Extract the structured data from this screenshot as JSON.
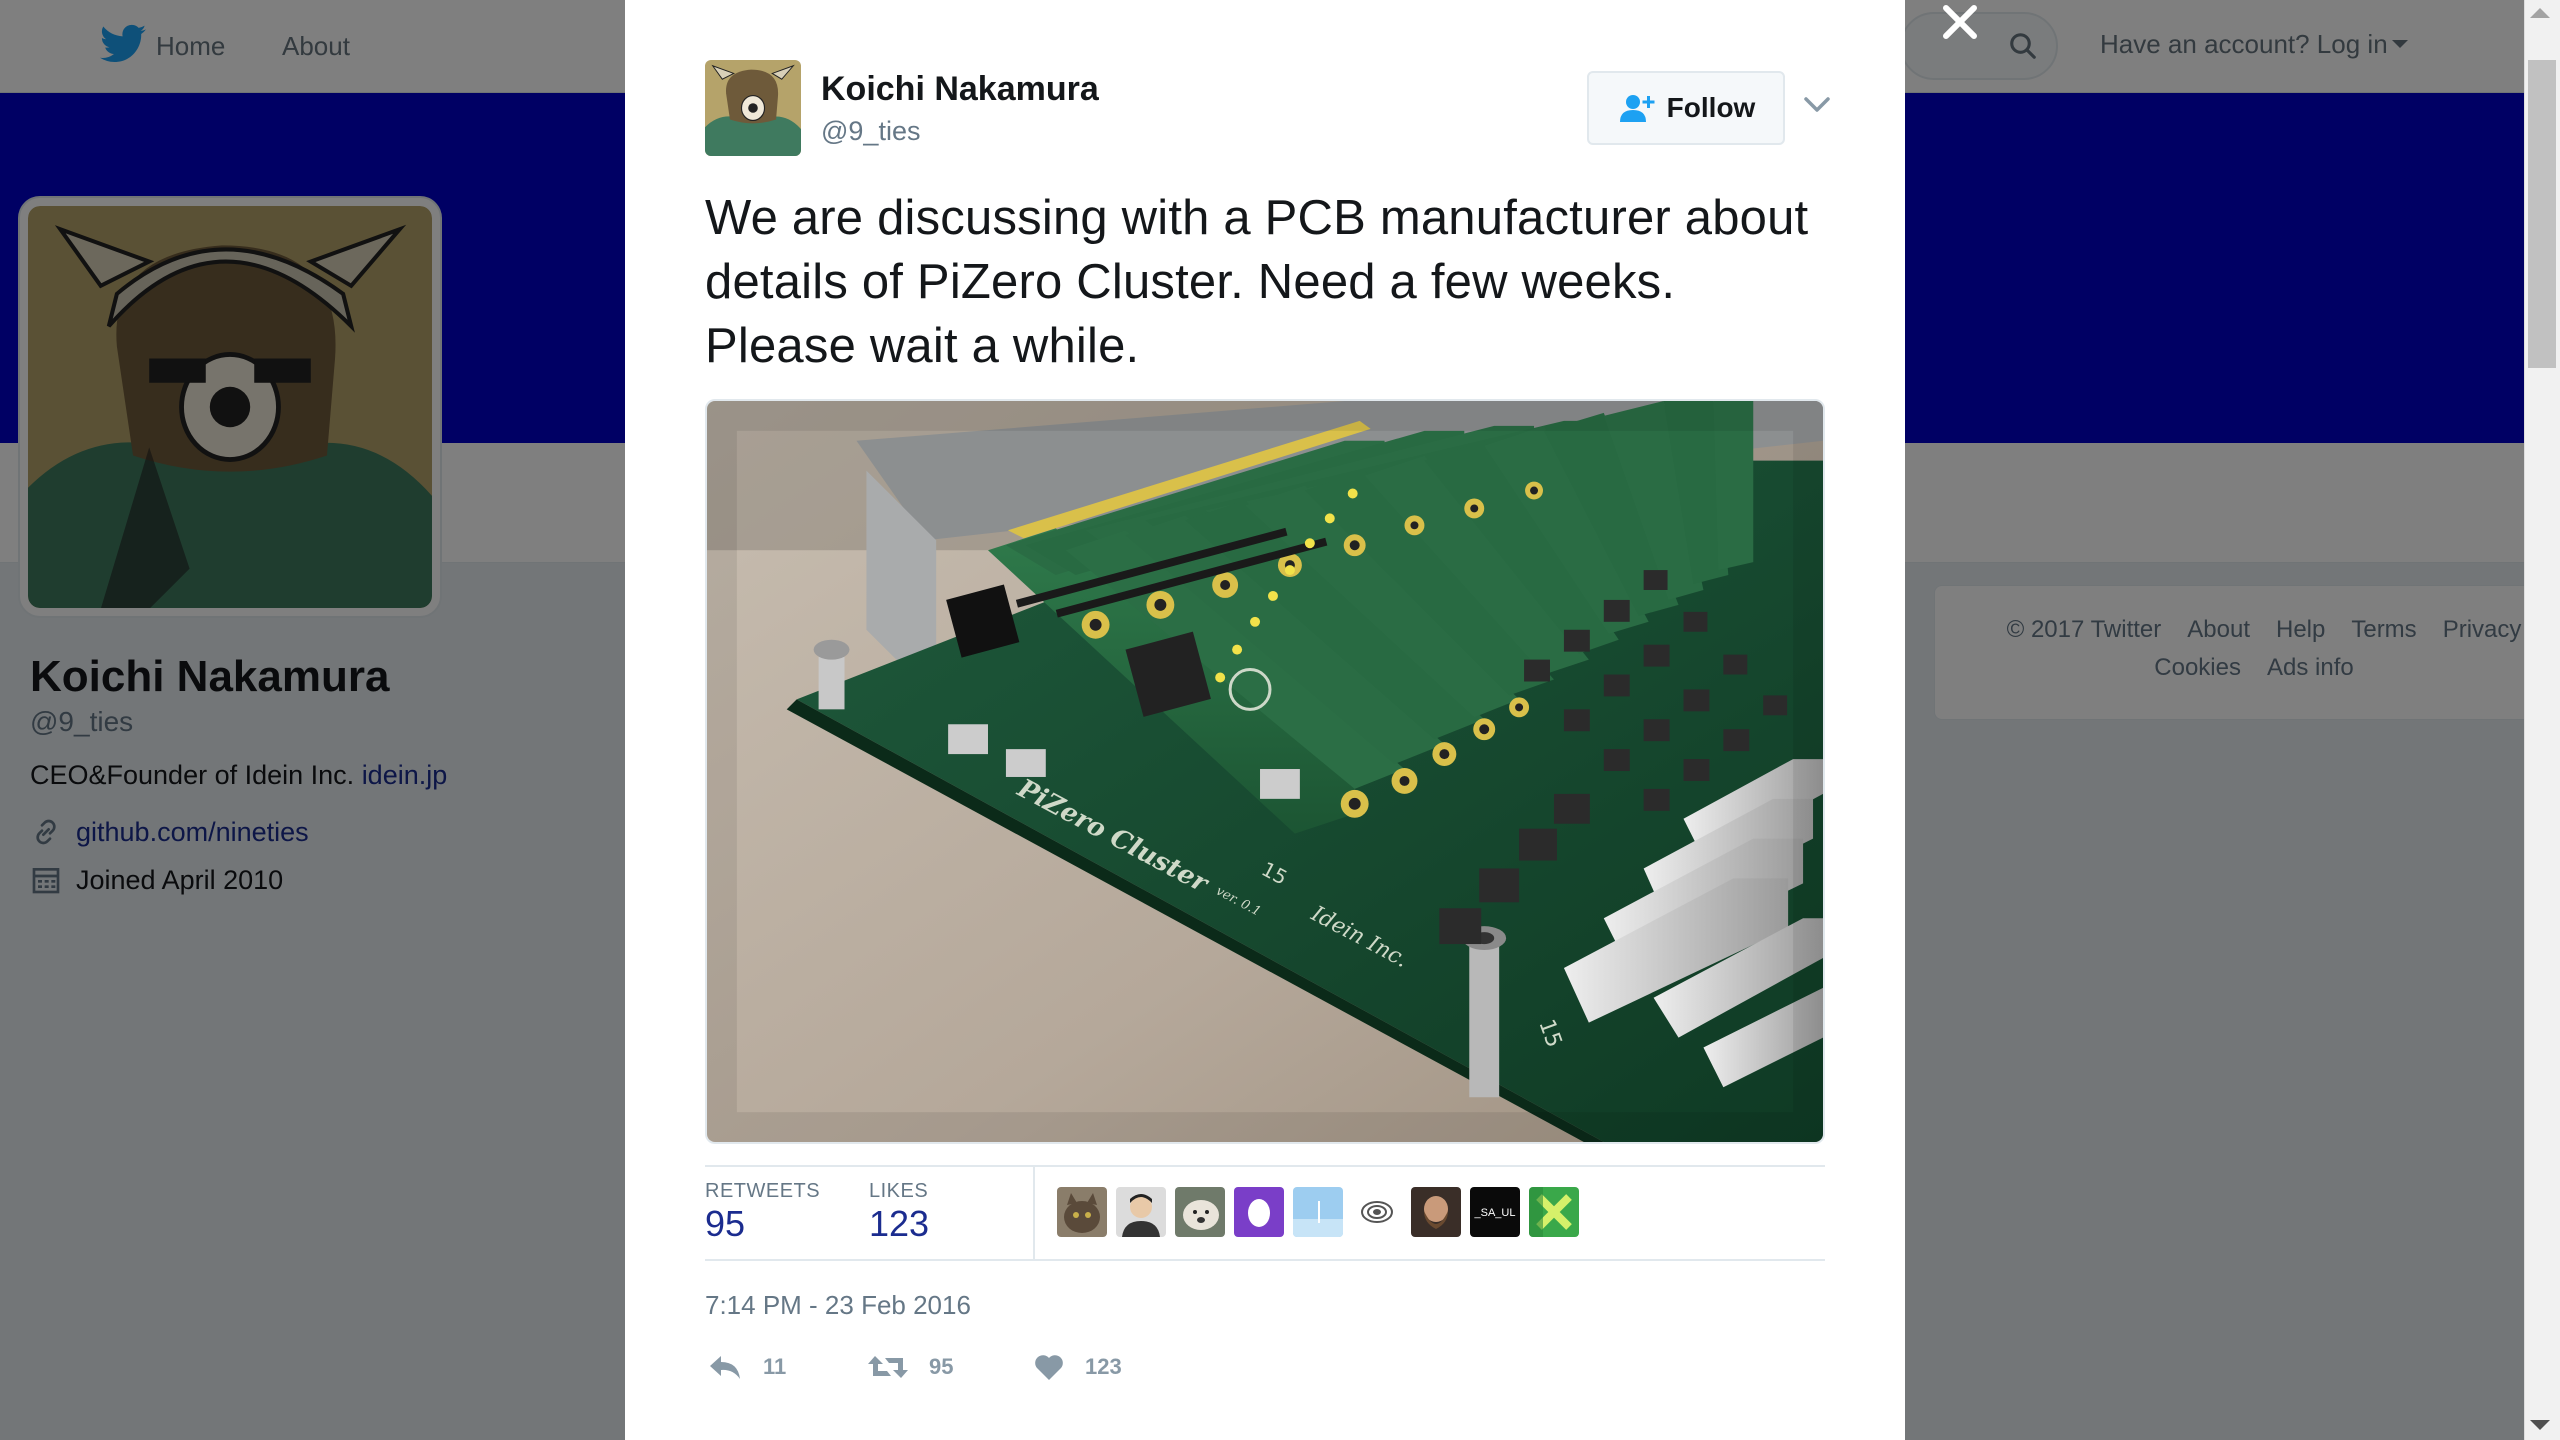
{
  "topbar": {
    "home": "Home",
    "about": "About",
    "login": "Have an account? Log in"
  },
  "profile": {
    "name": "Koichi Nakamura",
    "handle": "@9_ties",
    "bio": "CEO&Founder of Idein Inc. ",
    "bio_link": "idein.jp",
    "website": "github.com/nineties",
    "joined": "Joined April 2010"
  },
  "footer": {
    "links_row1": [
      "© 2017 Twitter",
      "About",
      "Help",
      "Terms",
      "Privacy"
    ],
    "links_row2": [
      "Cookies",
      "Ads info"
    ]
  },
  "tweet": {
    "author_name": "Koichi Nakamura",
    "author_handle": "@9_ties",
    "follow_label": "Follow",
    "text": "We are discussing with a PCB manufacturer about details of PiZero Cluster. Need a few weeks. Please wait a while.",
    "retweets_label": "RETWEETS",
    "retweets_count": "95",
    "likes_label": "LIKES",
    "likes_count": "123",
    "timestamp": "7:14 PM - 23 Feb 2016",
    "actions": {
      "reply_count": "11",
      "retweet_count": "95",
      "like_count": "123"
    },
    "photo": {
      "board_label": "PiZero Cluster",
      "board_version": "ver. 0.1",
      "board_maker": "Idein Inc.",
      "slot_number": "15",
      "slot_number_right": "15"
    }
  },
  "likers": [
    "cat",
    "person",
    "dog",
    "purple-egg",
    "blue",
    "swirl",
    "bearded",
    "black-text",
    "green"
  ],
  "liker_labels": {
    "black-text": "_SA_UL"
  },
  "colors": {
    "banner": "#0000c8",
    "link": "#1b2c8f",
    "muted": "#657786",
    "overlay": "rgba(0,0,0,0.5)"
  }
}
